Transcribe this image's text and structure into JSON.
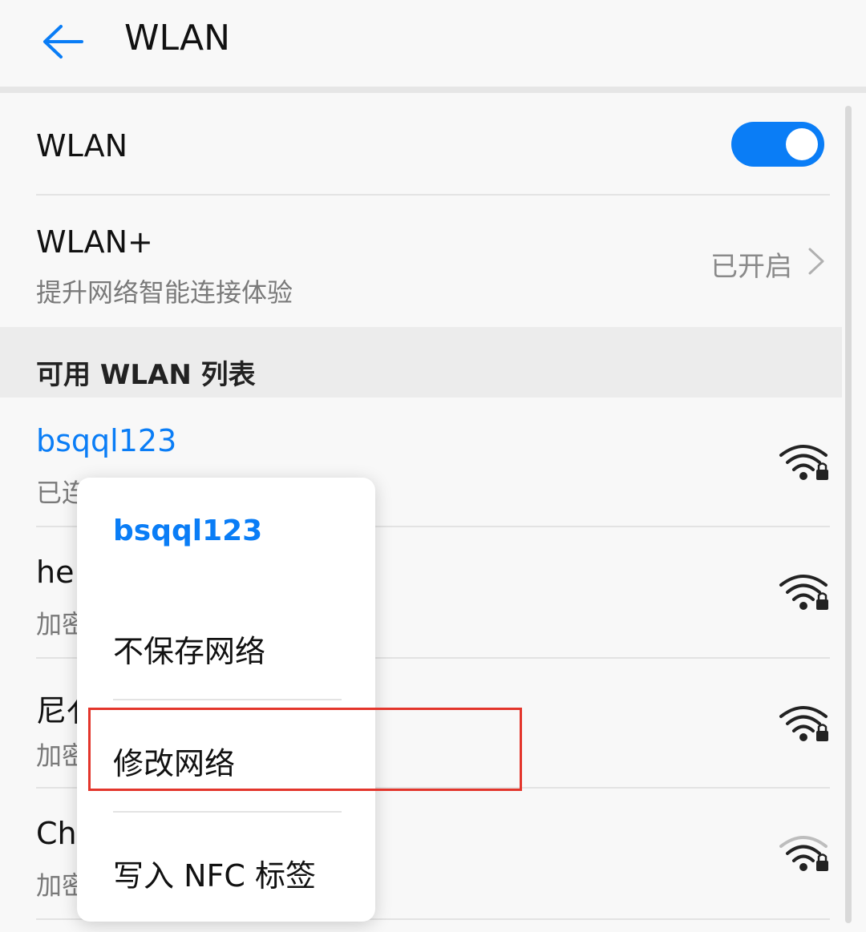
{
  "header": {
    "back_icon": "arrow-left-icon",
    "title": "WLAN"
  },
  "wlan_toggle": {
    "label": "WLAN",
    "on": true
  },
  "wlan_plus": {
    "label": "WLAN+",
    "subtitle": "提升网络智能连接体验",
    "value": "已开启",
    "chevron_icon": "chevron-right-icon"
  },
  "section": {
    "title": "可用 WLAN 列表"
  },
  "networks": [
    {
      "name": "bsqql123",
      "subtitle": "已连",
      "connected": true,
      "icon": "wifi-locked-icon"
    },
    {
      "name": "hel",
      "subtitle": "加密",
      "connected": false,
      "icon": "wifi-locked-icon"
    },
    {
      "name": "尼亻",
      "subtitle": "加密",
      "connected": false,
      "icon": "wifi-locked-icon"
    },
    {
      "name": "Ch",
      "subtitle": "加密",
      "connected": false,
      "icon": "wifi-locked-icon"
    }
  ],
  "context_menu": {
    "title": "bsqql123",
    "items": [
      "不保存网络",
      "修改网络",
      "写入 NFC 标签"
    ]
  },
  "colors": {
    "accent": "#0a7df6",
    "highlight_border": "#e3352b"
  }
}
